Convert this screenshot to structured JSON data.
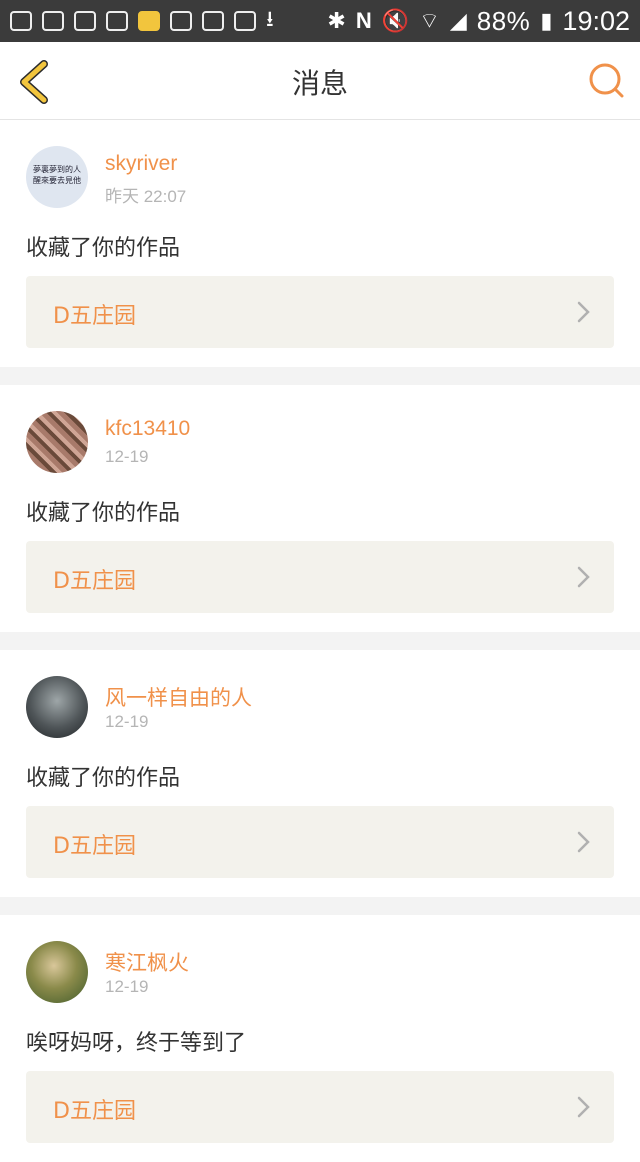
{
  "status_bar": {
    "battery": "88%",
    "time": "19:02"
  },
  "header": {
    "title": "消息"
  },
  "messages": [
    {
      "username": "skyriver",
      "time": "昨天 22:07",
      "action": "收藏了你的作品",
      "work_title": "D五庄园",
      "avatar_text": "夢裏夢到的人\n醒來要去見他"
    },
    {
      "username": "kfc13410",
      "time": "12-19",
      "action": "收藏了你的作品",
      "work_title": "D五庄园"
    },
    {
      "username": "风一样自由的人",
      "time": "12-19",
      "action": "收藏了你的作品",
      "work_title": "D五庄园"
    },
    {
      "username": "寒江枫火",
      "time": "12-19",
      "action": "唉呀妈呀，终于等到了",
      "work_title": "D五庄园"
    }
  ],
  "colors": {
    "accent": "#f0914a",
    "back_arrow": "#f2c53d"
  }
}
